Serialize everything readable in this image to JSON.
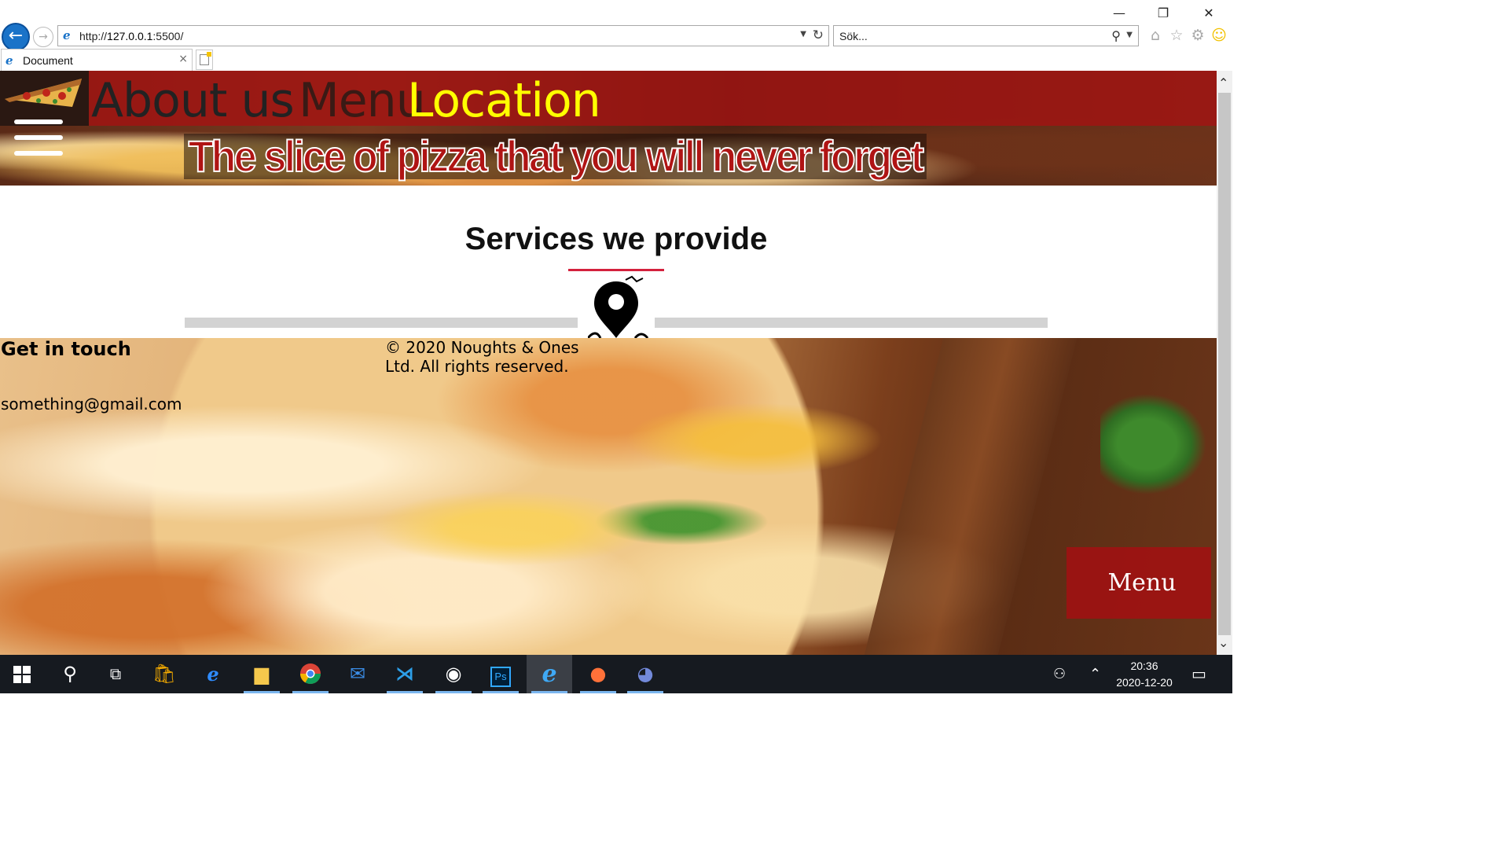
{
  "window": {
    "minimize_glyph": "—",
    "restore_glyph": "❐",
    "close_glyph": "✕"
  },
  "toolbar": {
    "back_glyph": "←",
    "forward_glyph": "→",
    "address_scheme": "http://",
    "address_host": "127.0.0.1",
    "address_port_path": ":5500/",
    "search_placeholder": "Sök...",
    "icons": [
      "home-icon",
      "favorites-star-icon",
      "settings-gear-icon",
      "feedback-smiley-icon"
    ]
  },
  "tab": {
    "title": "Document",
    "close_glyph": "×"
  },
  "page": {
    "nav": {
      "about": "About us",
      "menu": "Menu",
      "location": "Location"
    },
    "tagline": "The slice of pizza that you will never forget",
    "services_title": "Services we provide",
    "footer": {
      "heading": "Get in touch",
      "email": "something@gmail.com",
      "copyright": "© 2020 Noughts & Ones Ltd. All rights reserved.",
      "menu_button": "Menu"
    },
    "colors": {
      "nav_red": "#a51212",
      "location_yellow": "#ffff00",
      "underline_red": "#d4213d"
    }
  },
  "taskbar": {
    "apps": [
      "windows-start",
      "search",
      "task-view",
      "microsoft-store",
      "edge",
      "file-explorer",
      "chrome",
      "mail",
      "vscode",
      "github-desktop",
      "photoshop",
      "internet-explorer",
      "firefox",
      "discord"
    ],
    "time": "20:36",
    "date": "2020-12-20"
  }
}
